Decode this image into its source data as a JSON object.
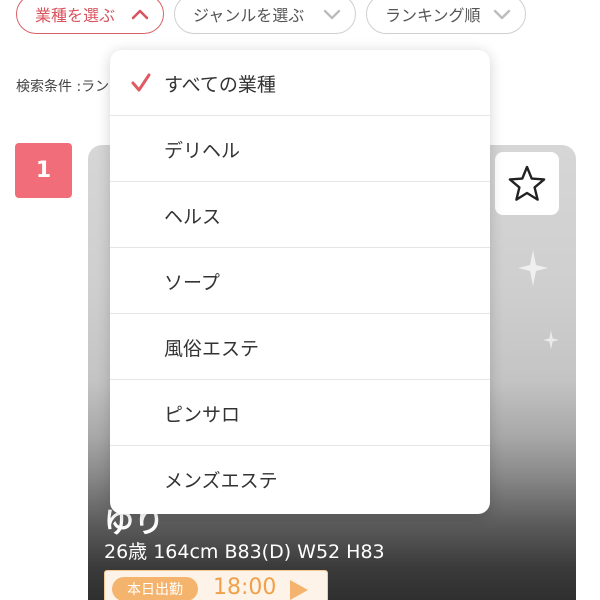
{
  "filters": [
    {
      "label": "業種を選ぶ",
      "icon": "chevron-up-icon",
      "active": true
    },
    {
      "label": "ジャンルを選ぶ",
      "icon": "chevron-down-icon",
      "active": false
    },
    {
      "label": "ランキング順",
      "icon": "chevron-down-icon",
      "active": false
    }
  ],
  "search_condition": "検索条件 :ラン",
  "rank": "1",
  "girl": {
    "name": "ゆり",
    "stats": "26歳 164cm B83(D) W52 H83",
    "today_badge": "本日出勤",
    "time": "18:00"
  },
  "dropdown": {
    "selected_index": 0,
    "items": [
      {
        "label": "すべての業種"
      },
      {
        "label": "デリヘル"
      },
      {
        "label": "ヘルス"
      },
      {
        "label": "ソープ"
      },
      {
        "label": "風俗エステ"
      },
      {
        "label": "ピンサロ"
      },
      {
        "label": "メンズエステ"
      }
    ]
  },
  "colors": {
    "accent": "#d9545e",
    "rank_badge": "#f26d7a",
    "schedule_orange": "#f5b46d"
  }
}
